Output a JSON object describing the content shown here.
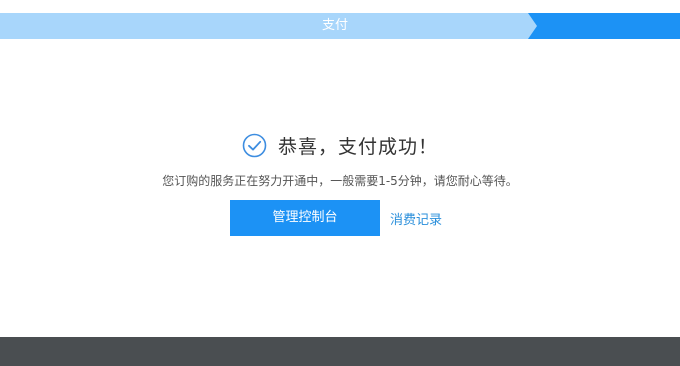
{
  "stepbar": {
    "step_label": "支付",
    "colors": {
      "inactive": "#a8d6fb",
      "active": "#1c92f5"
    }
  },
  "success": {
    "icon": "check-circle-icon",
    "title": "恭喜，支付成功！",
    "message": "您订购的服务正在努力开通中，一般需要1-5分钟，请您耐心等待。"
  },
  "actions": {
    "console_button": "管理控制台",
    "records_link": "消费记录"
  },
  "colors": {
    "accent": "#1c92f5",
    "link": "#2a8fdb",
    "footer": "#4a4e51"
  }
}
